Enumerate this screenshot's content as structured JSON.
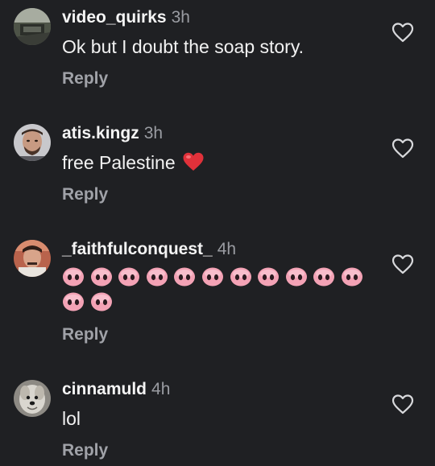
{
  "comments": [
    {
      "username": "video_quirks",
      "time": "3h",
      "text": "Ok but I doubt the soap story.",
      "reply_label": "Reply"
    },
    {
      "username": "atis.kingz",
      "time": "3h",
      "text": "free Palestine",
      "emoji": "red-heart",
      "reply_label": "Reply"
    },
    {
      "username": "_faithfulconquest_",
      "time": "4h",
      "emoji": "pig-nose",
      "emoji_count": 13,
      "reply_label": "Reply"
    },
    {
      "username": "cinnamuld",
      "time": "4h",
      "text": "lol",
      "reply_label": "Reply"
    }
  ],
  "colors": {
    "background": "#1f2023",
    "username": "#f4f4f4",
    "secondary": "#9a9ca2",
    "heart_emoji": "#e0313a",
    "pig_emoji": "#f3a2b5"
  },
  "icons": {
    "like": "heart-outline-icon"
  }
}
